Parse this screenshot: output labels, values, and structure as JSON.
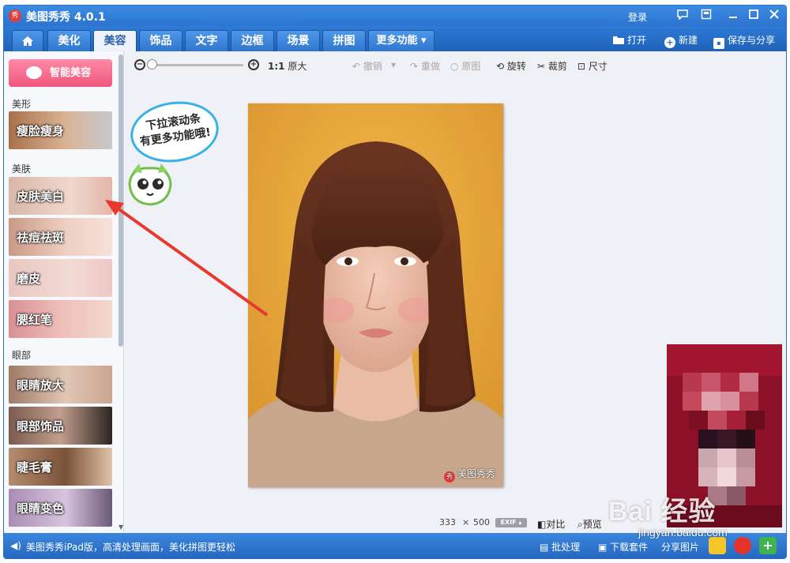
{
  "app": {
    "title": "美图秀秀 4.0.1",
    "logo_text": "秀",
    "login": "登录",
    "window_controls": [
      "message-icon",
      "skin-icon",
      "minimize-icon",
      "maximize-icon",
      "close-icon"
    ]
  },
  "tabs": [
    {
      "label": "",
      "icon": "home-icon"
    },
    {
      "label": "美化"
    },
    {
      "label": "美容",
      "active": true
    },
    {
      "label": "饰品"
    },
    {
      "label": "文字"
    },
    {
      "label": "边框"
    },
    {
      "label": "场景"
    },
    {
      "label": "拼图"
    },
    {
      "label": "更多功能 ▾"
    }
  ],
  "toolbar_right": {
    "open": "打开",
    "new": "新建",
    "save_share": "保存与分享"
  },
  "sidebar": {
    "smart_button": "智能美容",
    "sections": {
      "shape": "美形",
      "skin": "美肤",
      "eyes": "眼部"
    },
    "features": {
      "slim_face": "瘦脸瘦身",
      "whiten": "皮肤美白",
      "acne": "祛痘祛斑",
      "smooth": "磨皮",
      "blush": "腮红笔",
      "enlarge_eyes": "眼睛放大",
      "eye_deco": "眼部饰品",
      "mascara": "睫毛膏",
      "eye_color": "眼睛变色"
    }
  },
  "canvas_toolbar": {
    "ratio": "1:1",
    "original_size": "原大",
    "undo": "撤销",
    "redo": "重做",
    "original": "原图",
    "rotate": "旋转",
    "crop": "裁剪",
    "size": "尺寸"
  },
  "callout": {
    "line1": "下拉滚动条",
    "line2": "有更多功能哦!"
  },
  "photo": {
    "watermark": "美图秀秀",
    "watermark_badge": "秀",
    "width": "333",
    "times": "×",
    "height": "500",
    "exif": "EXIF ▴",
    "compare": "对比",
    "preview": "预览"
  },
  "statusbar": {
    "tip": "美图秀秀iPad版，高清处理画面，美化拼图更轻松",
    "batch": "批处理",
    "download": "下载套件",
    "share_image": "分享图片"
  },
  "watermark": {
    "brand": "Bai 经验",
    "url": "jingyan.baidu.com"
  },
  "colors": {
    "titlebar": "#2c74cf",
    "accent_pink": "#f0557e",
    "callout_border": "#38b0e8",
    "arrow": "#e8392f"
  }
}
